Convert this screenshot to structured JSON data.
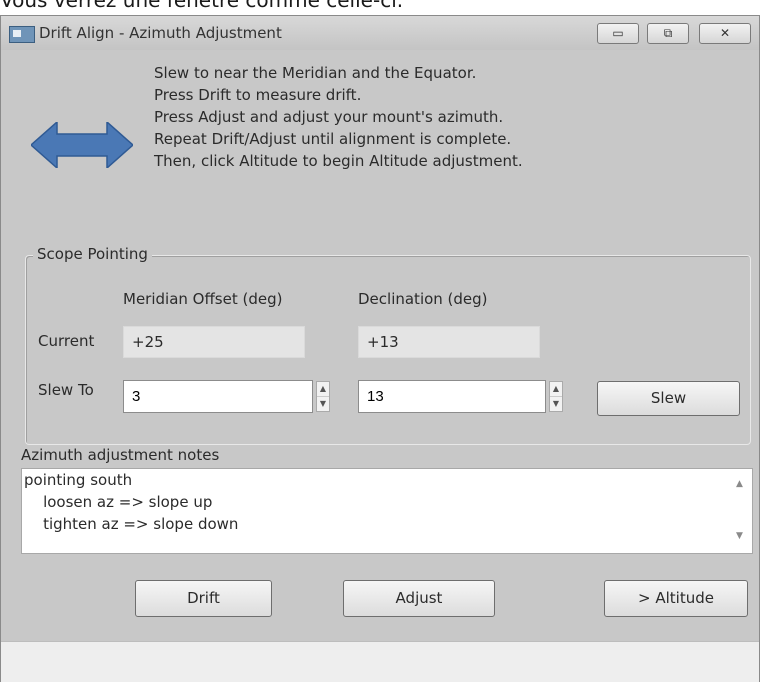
{
  "page_caption": "Vous verrez une fenêtre comme celle-ci.",
  "window": {
    "title": "Drift Align - Azimuth Adjustment",
    "controls": {
      "minimize": "▭",
      "maximize": "⧉",
      "close": "✕"
    }
  },
  "instructions": [
    "Slew to near the Meridian and the Equator.",
    "Press Drift to measure drift.",
    "Press Adjust and adjust your mount's azimuth.",
    "Repeat Drift/Adjust until alignment is complete.",
    "Then, click Altitude to begin Altitude adjustment."
  ],
  "scope_pointing": {
    "group_label": "Scope Pointing",
    "col_meridian": "Meridian Offset (deg)",
    "col_declination": "Declination (deg)",
    "row_current": "Current",
    "row_slew_to": "Slew To",
    "current_meridian": "+25",
    "current_declination": "+13",
    "slew_meridian": "3",
    "slew_declination": "13",
    "slew_button": "Slew"
  },
  "notes": {
    "label": "Azimuth adjustment notes",
    "lines": [
      "pointing south",
      "    loosen az => slope up",
      "    tighten az => slope down"
    ]
  },
  "buttons": {
    "drift": "Drift",
    "adjust": "Adjust",
    "altitude": "> Altitude"
  },
  "colors": {
    "arrow": "#4a78b5",
    "window_bg": "#c8c8c8"
  }
}
